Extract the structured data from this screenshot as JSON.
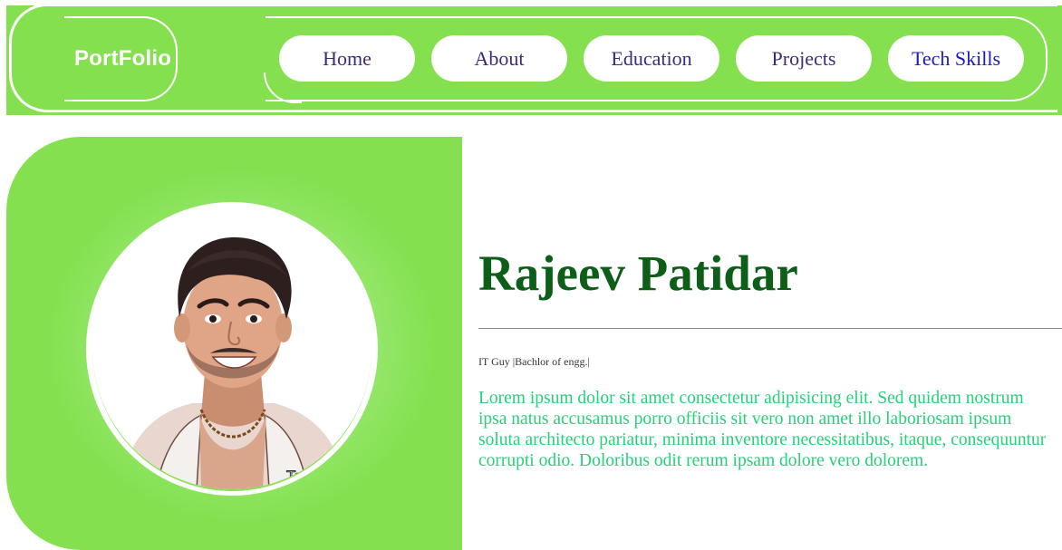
{
  "navbar": {
    "logo": "PortFolio",
    "items": [
      {
        "label": "Home"
      },
      {
        "label": "About"
      },
      {
        "label": "Education"
      },
      {
        "label": "Projects"
      },
      {
        "label": "Tech Skills"
      }
    ],
    "active_index": 4
  },
  "hero": {
    "name": "Rajeev Patidar",
    "tagline": "IT Guy |Bachlor of engg.|",
    "bio": "Lorem ipsum dolor sit amet consectetur adipisicing elit. Sed quidem nostrum ipsa natus accusamus porro officiis sit vero non amet illo laboriosam ipsum soluta architecto pariatur, minima inventore necessitatibus, itaque, consequuntur corrupti odio. Doloribus odit rerum ipsam dolore vero dolorem.",
    "avatar_watermark": "Too"
  },
  "colors": {
    "brand_green": "#84e04e",
    "name_green": "#0d5f18",
    "bio_green": "#27d07a",
    "nav_text": "#3d2a7a",
    "nav_active_text": "#1a18c9"
  }
}
